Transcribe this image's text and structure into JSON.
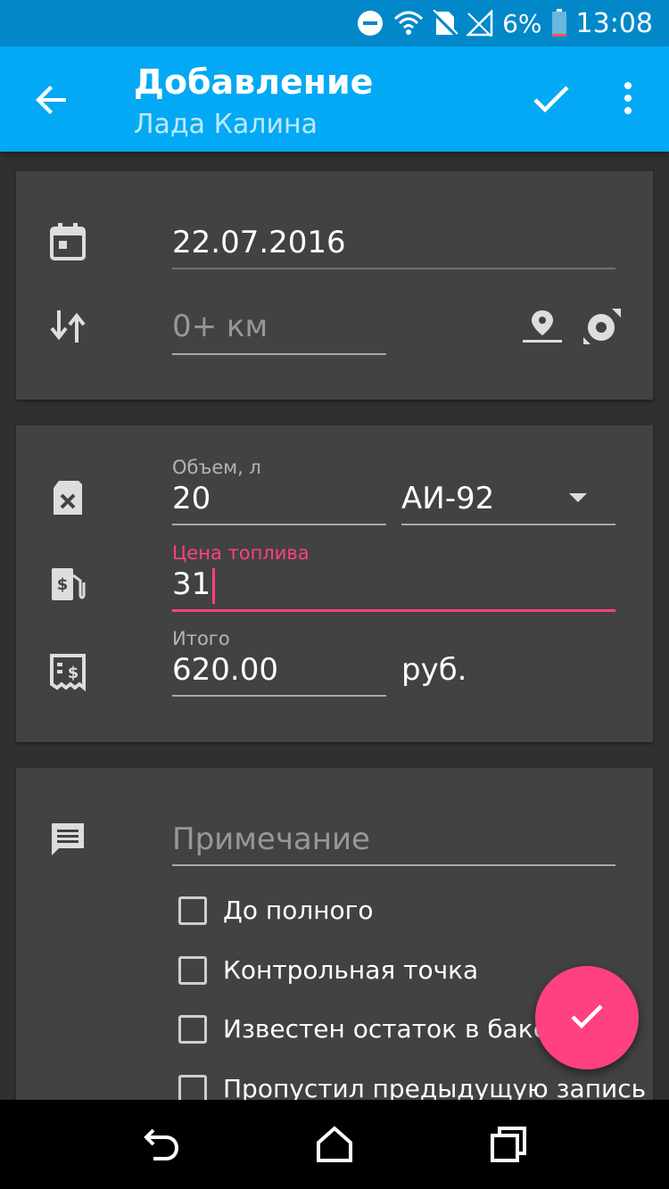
{
  "status_bar": {
    "battery": "6%",
    "time": "13:08",
    "icons": [
      "do-not-disturb-icon",
      "wifi-icon",
      "no-sim-icon",
      "signal-icon",
      "battery-icon"
    ]
  },
  "app_bar": {
    "title": "Добавление",
    "subtitle": "Лада Калина",
    "icons": [
      "back-arrow-icon",
      "check-icon",
      "more-vert-icon"
    ]
  },
  "trip": {
    "date_value": "22.07.2016",
    "odometer_placeholder": "0+  км",
    "icons": [
      "calendar-icon",
      "odometer-swap-icon",
      "location-pin-icon",
      "gps-track-icon"
    ]
  },
  "fuel": {
    "volume_label": "Объем, л",
    "volume_value": "20",
    "fuel_type_value": "АИ-92",
    "price_label": "Цена топлива",
    "price_value": "31",
    "total_label": "Итого",
    "total_value": "620.00",
    "currency": "руб.",
    "icons": [
      "fuel-canister-icon",
      "fuel-price-icon",
      "receipt-icon",
      "dropdown-arrow-icon"
    ]
  },
  "notes": {
    "note_placeholder": "Примечание",
    "checkboxes": [
      {
        "label": "До полного",
        "checked": false
      },
      {
        "label": "Контрольная точка",
        "checked": false
      },
      {
        "label": "Известен остаток в баке",
        "checked": false
      },
      {
        "label": "Пропустил предыдущую запись",
        "checked": false
      }
    ],
    "icons": [
      "comment-icon"
    ]
  },
  "colors": {
    "primary": "#03a9f4",
    "primary_dark": "#0288c9",
    "accent": "#ff4081",
    "background": "#303030",
    "card": "#424242"
  },
  "nav_bar": {
    "icons": [
      "back-nav-icon",
      "home-nav-icon",
      "recents-nav-icon"
    ]
  }
}
